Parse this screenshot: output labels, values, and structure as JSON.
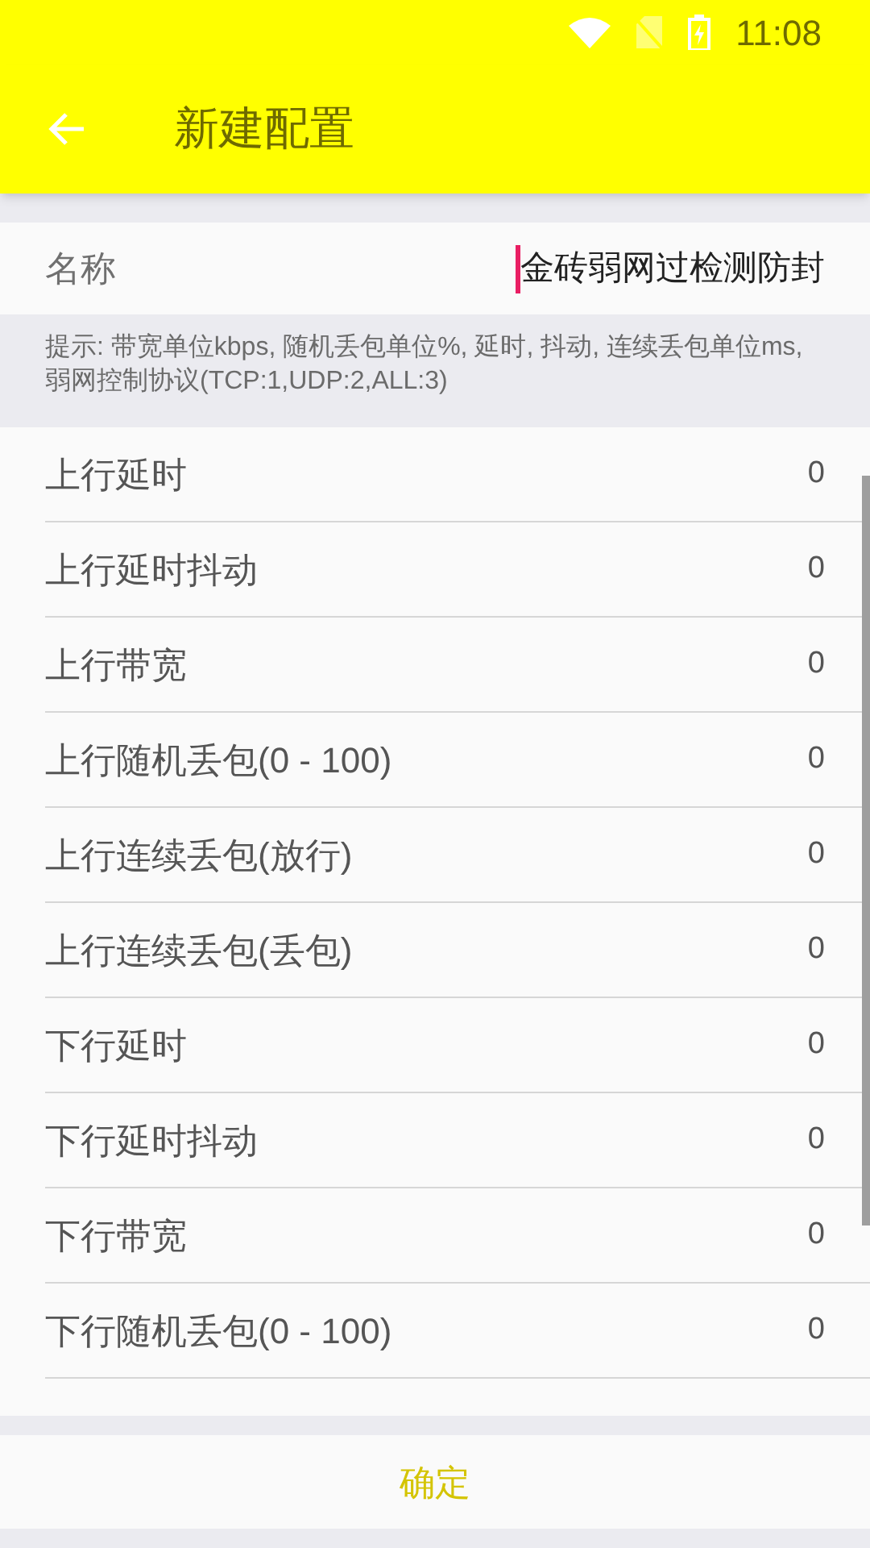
{
  "status_bar": {
    "time": "11:08"
  },
  "toolbar": {
    "title": "新建配置"
  },
  "name_field": {
    "label": "名称",
    "value": "金砖弱网过检测防封"
  },
  "hint": "提示: 带宽单位kbps, 随机丢包单位%, 延时, 抖动, 连续丢包单位ms, 弱网控制协议(TCP:1,UDP:2,ALL:3)",
  "settings": [
    {
      "label": "上行延时",
      "value": "0"
    },
    {
      "label": "上行延时抖动",
      "value": "0"
    },
    {
      "label": "上行带宽",
      "value": "0"
    },
    {
      "label": "上行随机丢包(0 - 100)",
      "value": "0"
    },
    {
      "label": "上行连续丢包(放行)",
      "value": "0"
    },
    {
      "label": "上行连续丢包(丢包)",
      "value": "0"
    },
    {
      "label": "下行延时",
      "value": "0"
    },
    {
      "label": "下行延时抖动",
      "value": "0"
    },
    {
      "label": "下行带宽",
      "value": "0"
    },
    {
      "label": "下行随机丢包(0 - 100)",
      "value": "0"
    }
  ],
  "confirm_button": "确定"
}
